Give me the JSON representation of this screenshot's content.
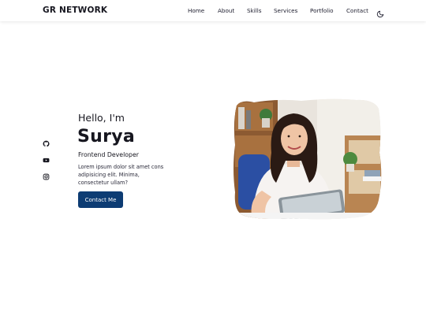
{
  "header": {
    "logo": "GR NETWORK",
    "nav": [
      "Home",
      "About",
      "Skills",
      "Services",
      "Portfolio",
      "Contact"
    ],
    "theme_toggle_icon": "moon-icon"
  },
  "socials": [
    {
      "icon": "github-icon"
    },
    {
      "icon": "youtube-icon"
    },
    {
      "icon": "instagram-icon"
    }
  ],
  "hero": {
    "greeting": "Hello, I'm",
    "name": "Surya",
    "role": "Frontend Developer",
    "description": "Lorem ipsum dolor sit amet cons adipisicing elit. Minima, consectetur ullam?",
    "cta_label": "Contact Me",
    "image_icon": "profile-photo"
  },
  "colors": {
    "accent": "#0d3c73",
    "text": "#16161f",
    "background": "#ffffff"
  }
}
